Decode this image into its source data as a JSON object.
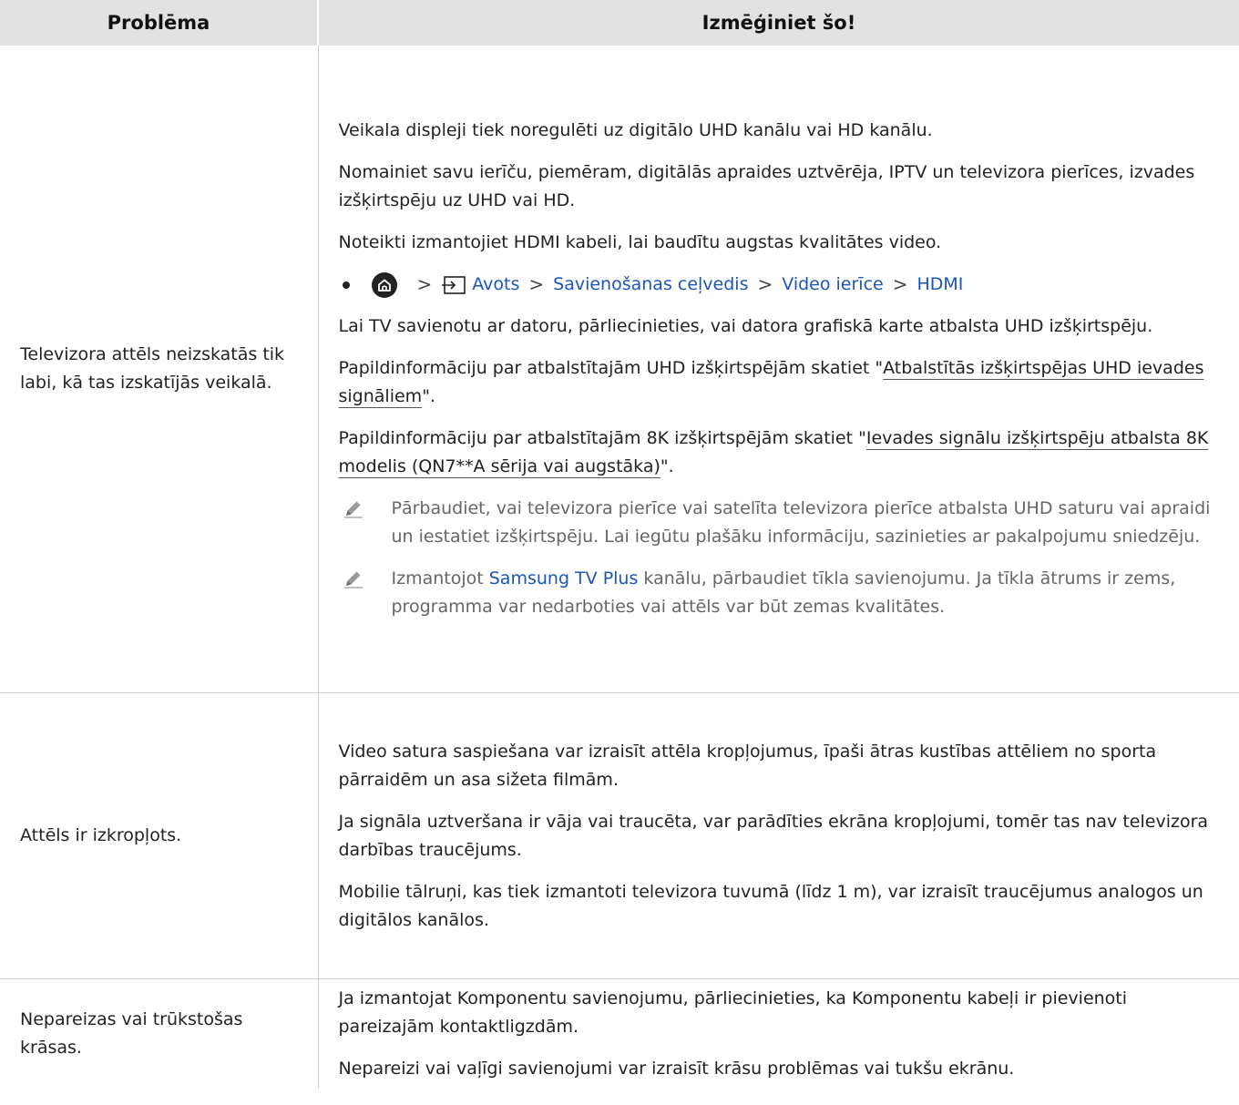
{
  "table": {
    "header": {
      "col1": "Problēma",
      "col2": "Izmēģiniet šo!"
    },
    "rows": [
      {
        "problem": "Televizora attēls neizskatās tik labi, kā tas izskatījās veikalā.",
        "p1": "Veikala displeji tiek noregulēti uz digitālo UHD kanālu vai HD kanālu.",
        "p2": "Nomainiet savu ierīču, piemēram, digitālās apraides uztvērēja, IPTV un televizora pierīces, izvades izšķirtspēju uz UHD vai HD.",
        "p3": "Noteikti izmantojiet HDMI kabeli, lai baudītu augstas kvalitātes video.",
        "nav": {
          "icons": {
            "home": "home-icon",
            "source": "source-icon",
            "chevron": "chevron-right-icon",
            "bullet": "bullet-icon"
          },
          "sep": ">",
          "items": [
            "Avots",
            "Savienošanas ceļvedis",
            "Video ierīce",
            "HDMI"
          ]
        },
        "p4": "Lai TV savienotu ar datoru, pārliecinieties, vai datora grafiskā karte atbalsta UHD izšķirtspēju.",
        "p5_pre": "Papildinformāciju par atbalstītajām UHD izšķirtspējām skatiet \"",
        "p5_link": "Atbalstītās izšķirtspējas UHD ievades signāliem",
        "p5_post": "\".",
        "p6_pre": "Papildinformāciju par atbalstītajām 8K izšķirtspējām skatiet \"",
        "p6_link": "Ievades signālu izšķirtspēju atbalsta 8K modelis (QN7**A sērija vai augstāka)",
        "p6_post": "\".",
        "note1": "Pārbaudiet, vai televizora pierīce vai satelīta televizora pierīce atbalsta UHD saturu vai apraidi un iestatiet izšķirtspēju. Lai iegūtu plašāku informāciju, sazinieties ar pakalpojumu sniedzēju.",
        "note2_pre": "Izmantojot ",
        "note2_link": "Samsung TV Plus",
        "note2_post": " kanālu, pārbaudiet tīkla savienojumu. Ja tīkla ātrums ir zems, programma var nedarboties vai attēls var būt zemas kvalitātes.",
        "note_icon": "pencil-note-icon"
      },
      {
        "problem": "Attēls ir izkropļots.",
        "p1": "Video satura saspiešana var izraisīt attēla kropļojumus, īpaši ātras kustības attēliem no sporta pārraidēm un asa sižeta filmām.",
        "p2": "Ja signāla uztveršana ir vāja vai traucēta, var parādīties ekrāna kropļojumi, tomēr tas nav televizora darbības traucējums.",
        "p3": "Mobilie tālruņi, kas tiek izmantoti televizora tuvumā (līdz 1 m), var izraisīt traucējumus analogos un digitālos kanālos."
      },
      {
        "problem": "Nepareizas vai trūkstošas krāsas.",
        "p1": "Ja izmantojat Komponentu savienojumu, pārliecinieties, ka Komponentu kabeļi ir pievienoti pareizajām kontaktligzdām.",
        "p2": "Nepareizi vai vaļīgi savienojumi var izraisīt krāsu problēmas vai tukšu ekrānu."
      }
    ]
  },
  "colors": {
    "header_bg": "#e2e2e2",
    "link_blue": "#1a56b8",
    "border": "#cfcfcf",
    "note_text": "#666666"
  }
}
